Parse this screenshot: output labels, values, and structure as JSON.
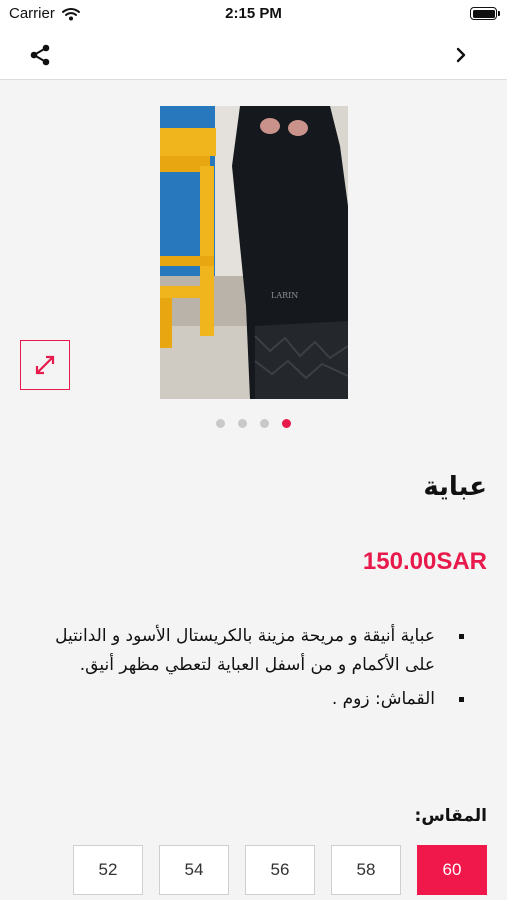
{
  "status_bar": {
    "carrier": "Carrier",
    "time": "2:15 PM"
  },
  "nav": {
    "share_icon": "share-icon",
    "forward_icon": "chevron-right-icon"
  },
  "gallery": {
    "image_count": 4,
    "active_index": 3,
    "expand_icon": "expand-arrows-icon",
    "image_brand_text": "LARIN"
  },
  "product": {
    "title": "عباية",
    "price": "150.00SAR",
    "description": [
      "عباية أنيقة و مريحة مزينة بالكريستال الأسود و الدانتيل على الأكمام و من أسفل العباية لتعطي مظهر أنيق.",
      "القماش: زوم ."
    ]
  },
  "sizes": {
    "label": "المقاس:",
    "options": [
      "60",
      "58",
      "56",
      "54",
      "52"
    ],
    "selected": "60"
  },
  "colors": {
    "accent": "#e8194b",
    "selected_size_bg": "#f0174a",
    "background": "#f4f4f4"
  }
}
